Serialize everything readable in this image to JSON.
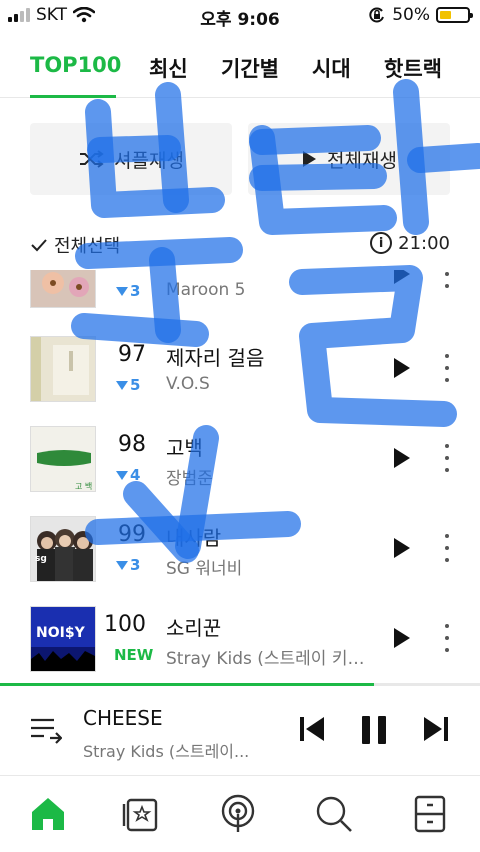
{
  "status_bar": {
    "carrier": "SKT",
    "time": "오후 9:06",
    "battery_percent": "50%",
    "battery_level": 0.5
  },
  "tabs": [
    {
      "label": "TOP100",
      "active": true
    },
    {
      "label": "최신"
    },
    {
      "label": "기간별"
    },
    {
      "label": "시대"
    },
    {
      "label": "핫트랙"
    }
  ],
  "buttons": {
    "shuffle_label": "셔플재생",
    "play_all_label": "전체재생"
  },
  "select_row": {
    "select_all_label": "전체선택",
    "time": "21:00"
  },
  "chart_list": [
    {
      "rank": "",
      "change": "3",
      "change_type": "down",
      "title": "",
      "artist": "Maroon 5"
    },
    {
      "rank": "97",
      "change": "5",
      "change_type": "down",
      "title": "제자리 걸음",
      "artist": "V.O.S"
    },
    {
      "rank": "98",
      "change": "4",
      "change_type": "down",
      "title": "고백",
      "artist": "장범준"
    },
    {
      "rank": "99",
      "change": "3",
      "change_type": "down",
      "title": "내사람",
      "artist": "SG 워너비"
    },
    {
      "rank": "100",
      "change": "NEW",
      "change_type": "new",
      "title": "소리꾼",
      "artist": "Stray Kids (스트레이 키…"
    }
  ],
  "album_art_text": {
    "noisy": "NOI$Y",
    "gobaek": "고 백",
    "sg": "sg"
  },
  "now_playing": {
    "title": "CHEESE",
    "artist": "Stray Kids (스트레이...",
    "progress": 0.78
  },
  "watermark": {
    "text": "부반님"
  },
  "colors": {
    "accent": "#1cb946",
    "rank_down": "#3a8ee6",
    "watermark": "#1f6fe8"
  }
}
